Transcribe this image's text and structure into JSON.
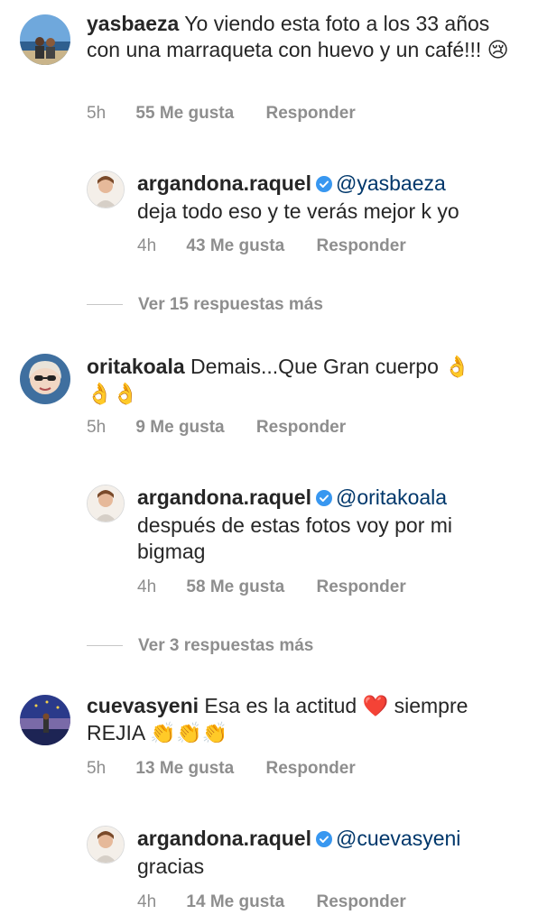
{
  "comments": [
    {
      "username": "yasbaeza",
      "text": "Yo viendo esta foto a los 33 años con una marraqueta con huevo y un café!!!",
      "emoji": "😢",
      "time": "5h",
      "likes": "55 Me gusta",
      "reply": "Responder",
      "avatar_icon": "avatar-beach-photo",
      "reply_item": {
        "username": "argandona.raquel",
        "mention": "@yasbaeza",
        "text": "deja todo eso y te verás mejor k yo",
        "time": "4h",
        "likes": "43 Me gusta",
        "reply": "Responder",
        "verified_icon": "verified-badge-icon"
      },
      "view_more": "Ver 15 respuestas más"
    },
    {
      "username": "oritakoala",
      "text": "Demais...Que Gran cuerpo",
      "emoji_inline": "👌",
      "emoji_line2": "👌👌",
      "time": "5h",
      "likes": "9 Me gusta",
      "reply": "Responder",
      "avatar_icon": "avatar-woman-sunglasses",
      "reply_item": {
        "username": "argandona.raquel",
        "mention": "@oritakoala",
        "text": "después de estas fotos voy por mi bigmag",
        "time": "4h",
        "likes": "58 Me gusta",
        "reply": "Responder",
        "verified_icon": "verified-badge-icon"
      },
      "view_more": "Ver 3 respuestas más"
    },
    {
      "username": "cuevasyeni",
      "text_part1": "Esa es la actitud",
      "heart": "❤️",
      "text_part2": "siempre",
      "text_line2": "REJIA",
      "clap": "👏👏👏",
      "time": "5h",
      "likes": "13 Me gusta",
      "reply": "Responder",
      "avatar_icon": "avatar-sunset-photo",
      "reply_item": {
        "username": "argandona.raquel",
        "mention": "@cuevasyeni",
        "text": "gracias",
        "time": "4h",
        "likes": "14 Me gusta",
        "reply": "Responder",
        "verified_icon": "verified-badge-icon"
      }
    }
  ],
  "colors": {
    "text": "#262626",
    "secondary": "#8e8e8e",
    "mention": "#00376b",
    "verified": "#3897f0"
  }
}
